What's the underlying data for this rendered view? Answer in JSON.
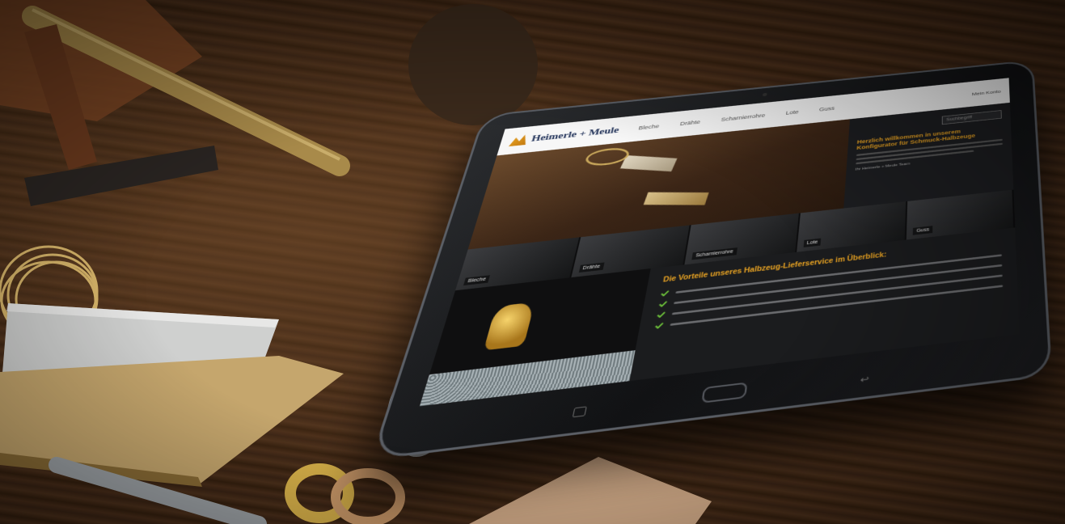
{
  "scene": {
    "description_colors": {
      "wood": "#3a2415",
      "gold": "#c9a85c",
      "accent": "#e8a323",
      "tablet": "#111214"
    }
  },
  "site": {
    "logo": {
      "name": "Heimerle + Meule"
    },
    "nav": [
      "Bleche",
      "Drähte",
      "Scharnierrohre",
      "Lote",
      "Guss"
    ],
    "account": "Mein Konto",
    "search_placeholder": "Suchbegriff",
    "welcome_title": "Herzlich willkommen in unserem Konfigurator für Schmuck-Halbzeuge",
    "welcome_sign": "Ihr Heimerle + Meule Team",
    "tiles": [
      "Bleche",
      "Drähte",
      "Scharnierrohre",
      "Lote",
      "Guss"
    ],
    "benefits_title": "Die Vorteile unseres Halbzeug-Lieferservice im Überblick:",
    "benefits_count": 4
  }
}
